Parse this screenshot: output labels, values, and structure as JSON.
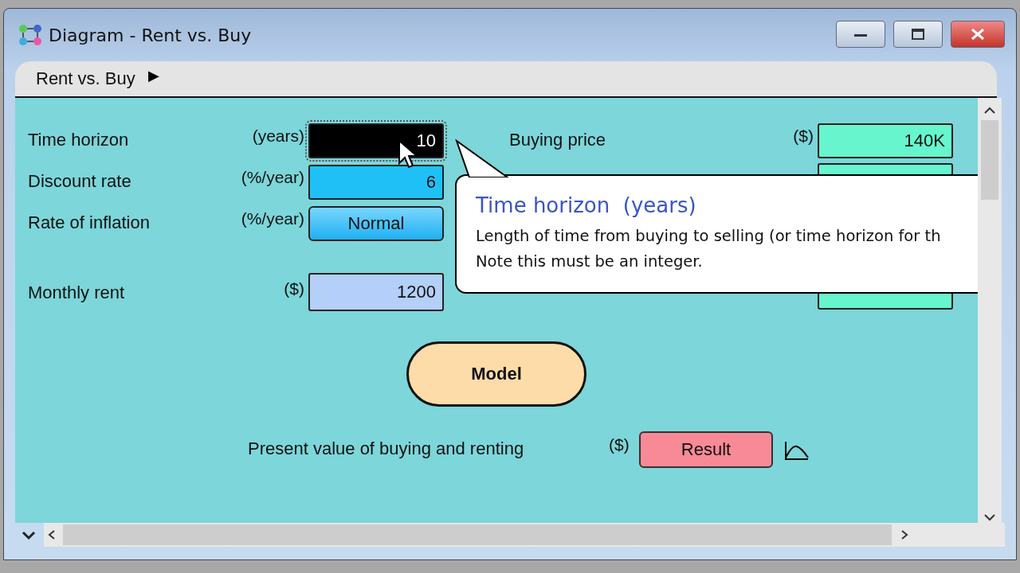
{
  "window": {
    "title": "Diagram - Rent vs. Buy"
  },
  "breadcrumb": {
    "label": "Rent vs. Buy",
    "arrow": "▶"
  },
  "inputs": [
    {
      "label": "Time horizon",
      "unit": "(years)",
      "value": "10",
      "kind": "field",
      "selected": true
    },
    {
      "label": "Discount rate",
      "unit": "(%/year)",
      "value": "6",
      "kind": "field",
      "selected": false
    },
    {
      "label": "Rate of inflation",
      "unit": "(%/year)",
      "value": "Normal",
      "kind": "choice",
      "selected": false
    },
    {
      "label": "Monthly rent",
      "unit": "($)",
      "value": "1200",
      "kind": "table",
      "selected": false
    },
    {
      "label": "Buying price",
      "unit": "($)",
      "value": "140K",
      "kind": "green_field",
      "selected": false
    }
  ],
  "model": {
    "label": "Model"
  },
  "output": {
    "label": "Present value of buying and renting",
    "unit": "($)",
    "button": "Result"
  },
  "tooltip": {
    "title": "Time horizon  (years)",
    "lines": [
      "Length of time from buying to selling (or time horizon for th",
      "Note this must be an integer."
    ]
  }
}
